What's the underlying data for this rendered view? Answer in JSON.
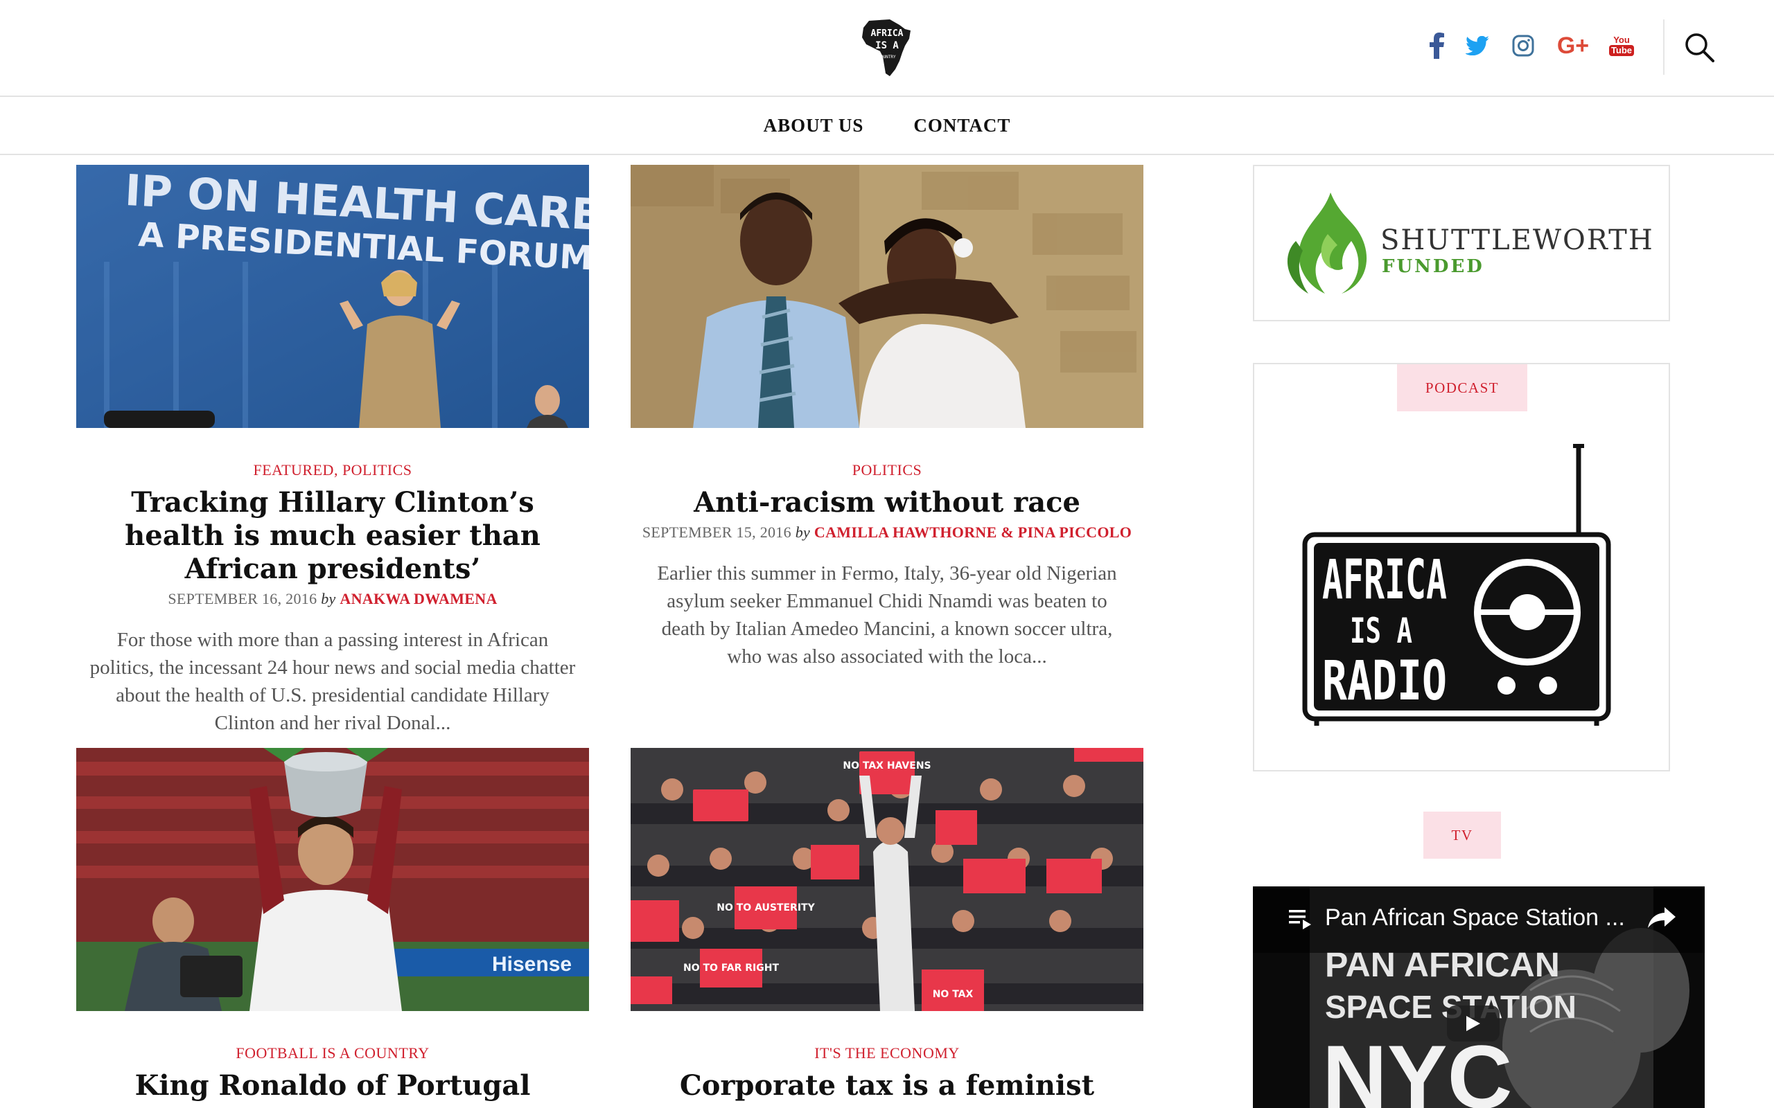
{
  "header": {
    "logo_text": "AFRICA IS A COUNTRY",
    "social": [
      {
        "name": "facebook",
        "icon": "facebook-icon",
        "color": "#3b5998"
      },
      {
        "name": "twitter",
        "icon": "twitter-icon",
        "color": "#1da1f2"
      },
      {
        "name": "instagram",
        "icon": "instagram-icon",
        "color": "#3f729b"
      },
      {
        "name": "google-plus",
        "icon": "google-plus-icon",
        "color": "#dd4b39"
      },
      {
        "name": "youtube",
        "icon": "youtube-icon",
        "color": "#cd201f"
      }
    ],
    "youtube_text": {
      "you": "You",
      "tube": "Tube"
    },
    "google_plus_text": "G+",
    "search_icon": "search-icon"
  },
  "nav": {
    "items": [
      "ABOUT US",
      "CONTACT"
    ]
  },
  "articles": [
    {
      "categories": [
        "FEATURED",
        "POLITICS"
      ],
      "title": "Tracking Hillary Clinton’s health is much easier than African presidents’",
      "date": "SEPTEMBER 16, 2016",
      "by": "by",
      "author": "ANAKWA DWAMENA",
      "excerpt": "For those with more than a passing interest in African politics, the incessant 24 hour news and social media chatter about the health of U.S. presidential candidate Hillary Clinton and her rival Donal...",
      "image_text": {
        "line1": "IP ON HEALTH CARE",
        "line2": "A PRESIDENTIAL FORUM"
      }
    },
    {
      "categories": [
        "POLITICS"
      ],
      "title": "Anti-racism without race",
      "date": "SEPTEMBER 15, 2016",
      "by": "by",
      "author": "CAMILLA HAWTHORNE & PINA PICCOLO",
      "excerpt": "Earlier this summer in Fermo, Italy, 36-year old Nigerian asylum seeker Emmanuel Chidi Nnamdi was beaten to death by Italian Amedeo Mancini, a known soccer ultra, who was also associated with the loca..."
    },
    {
      "categories": [
        "FOOTBALL IS A COUNTRY"
      ],
      "title": "King Ronaldo of Portugal",
      "image_text": {
        "banner": "Hisense"
      }
    },
    {
      "categories": [
        "IT'S THE ECONOMY"
      ],
      "title": "Corporate tax is a feminist matter",
      "image_text": {
        "sign1": "NO TAX HAVENS",
        "sign2": "NO TO AUSTERITY",
        "sign3": "NO TO FAR RIGHT",
        "sign4": "NO TAX"
      }
    }
  ],
  "sidebar": {
    "sponsor": {
      "name": "SHUTTLEWORTH",
      "sub": "FUNDED"
    },
    "podcast": {
      "label": "PODCAST",
      "radio_text": {
        "line1": "AFRICA",
        "line2": "IS A",
        "line3": "RADIO"
      }
    },
    "tv": {
      "label": "TV",
      "video_title": "Pan African Space Station ...",
      "overlay": {
        "line1": "PAN AFRICAN",
        "line2": "SPACE STATION",
        "line3": "NYC"
      }
    }
  }
}
